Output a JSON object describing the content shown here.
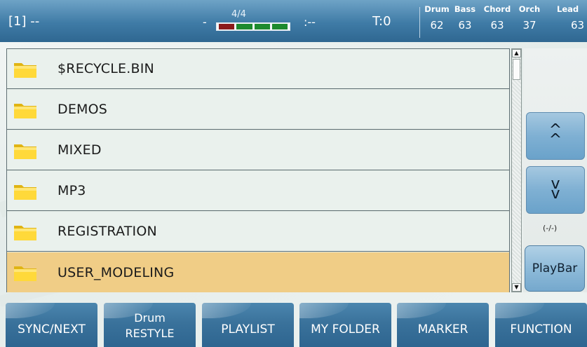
{
  "status_bar": {
    "slot": "[1] --",
    "time_signature": "4/4",
    "position_dash": "-",
    "bars": ":--",
    "tempo": "T:0",
    "meter_colors": [
      "#8b1a1a",
      "#1d8a2e",
      "#1d8a2e",
      "#1d8a2e"
    ],
    "mixer": [
      {
        "label": "Drum",
        "value": "62"
      },
      {
        "label": "Bass",
        "value": "63"
      },
      {
        "label": "Chord",
        "value": "63"
      },
      {
        "label": "Orch",
        "value": "37"
      },
      {
        "label": "Lead",
        "value": "63"
      }
    ]
  },
  "file_list": {
    "items": [
      {
        "name": "$RECYCLE.BIN",
        "icon": "folder-icon",
        "selected": false
      },
      {
        "name": "DEMOS",
        "icon": "folder-icon",
        "selected": false
      },
      {
        "name": "MIXED",
        "icon": "folder-icon",
        "selected": false
      },
      {
        "name": "MP3",
        "icon": "folder-icon",
        "selected": false
      },
      {
        "name": "REGISTRATION",
        "icon": "folder-icon",
        "selected": false
      },
      {
        "name": "USER_MODELING",
        "icon": "folder-icon",
        "selected": true
      }
    ],
    "selected_color": "#f0cd86"
  },
  "side_panel": {
    "page_up_label": "^",
    "page_down_label": "v",
    "counter": "(-/-)",
    "playbar_label": "PlayBar"
  },
  "function_buttons": [
    {
      "line1": "SYNC/NEXT"
    },
    {
      "line1": "Drum",
      "line2": "RESTYLE"
    },
    {
      "line1": "PLAYLIST"
    },
    {
      "line1": "MY FOLDER"
    },
    {
      "line1": "MARKER"
    },
    {
      "line1": "FUNCTION"
    }
  ],
  "colors": {
    "header_blue": "#3f7ba6",
    "button_blue": "#3a729b"
  }
}
